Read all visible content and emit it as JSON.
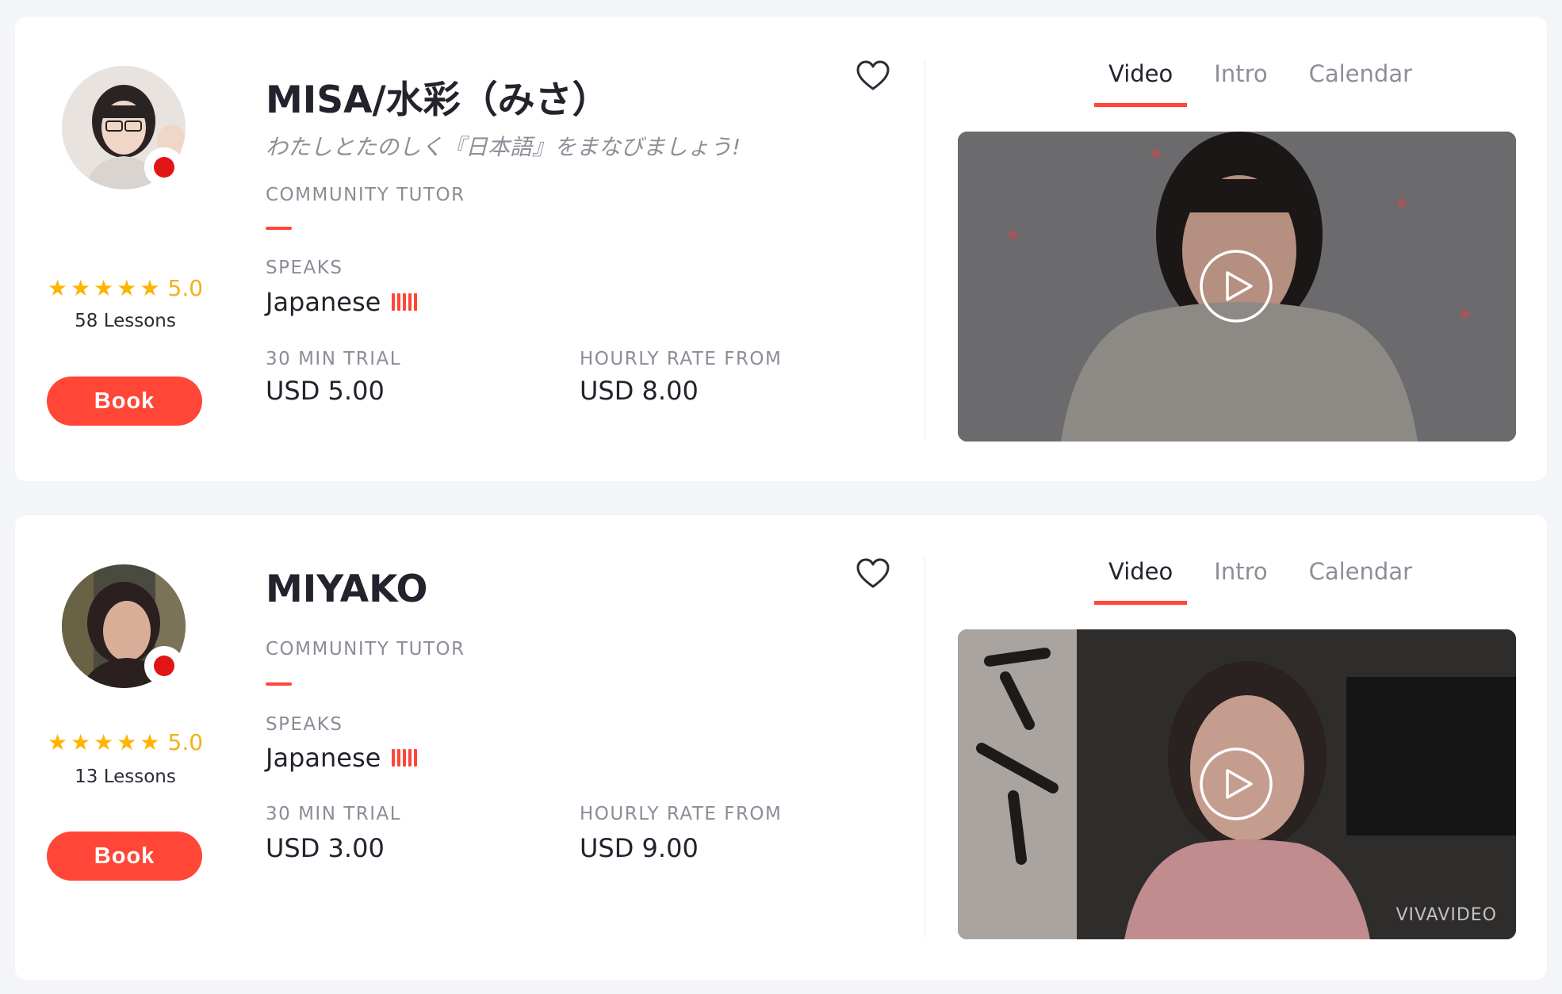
{
  "tutors": [
    {
      "name": "MISA/水彩（みさ）",
      "tagline": "わたしとたのしく『日本語』をまなびましょう!",
      "role": "COMMUNITY TUTOR",
      "rating": "5.0",
      "lessons": "58 Lessons",
      "book_label": "Book",
      "speaks_label": "SPEAKS",
      "language": "Japanese",
      "trial_label": "30 MIN TRIAL",
      "trial_price": "USD 5.00",
      "hourly_label": "HOURLY RATE FROM",
      "hourly_price": "USD 8.00",
      "tabs": [
        "Video",
        "Intro",
        "Calendar"
      ],
      "active_tab": "Video"
    },
    {
      "name": "MIYAKO",
      "tagline": "",
      "role": "COMMUNITY TUTOR",
      "rating": "5.0",
      "lessons": "13 Lessons",
      "book_label": "Book",
      "speaks_label": "SPEAKS",
      "language": "Japanese",
      "trial_label": "30 MIN TRIAL",
      "trial_price": "USD 3.00",
      "hourly_label": "HOURLY RATE FROM",
      "hourly_price": "USD 9.00",
      "tabs": [
        "Video",
        "Intro",
        "Calendar"
      ],
      "active_tab": "Video",
      "video_watermark": "VIVAVIDEO"
    }
  ],
  "icons": {
    "favorite": "heart-outline-icon",
    "play": "play-circle-icon",
    "flag": "japan-flag-icon",
    "rating": "star-icon"
  },
  "colors": {
    "accent": "#ff4637",
    "star": "#ffb400",
    "rating_text": "#f1b21a"
  }
}
